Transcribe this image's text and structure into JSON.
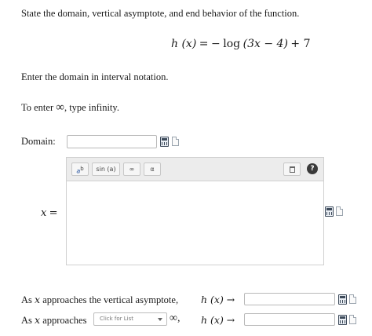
{
  "question": {
    "prompt": "State the domain, vertical asymptote, and end behavior of the function.",
    "function_lhs": "h (x)",
    "function_eq": "=",
    "function_minus": "−",
    "function_log": "log",
    "function_arg": "(3x − 4)",
    "function_plus": "+ 7"
  },
  "instructions": {
    "interval": "Enter the domain in interval notation.",
    "infinity_prefix": "To enter",
    "infinity_symbol": "∞",
    "infinity_suffix": ", type infinity."
  },
  "domain": {
    "label": "Domain:",
    "value": ""
  },
  "toolbar": {
    "power_base": "a",
    "power_exp": "b",
    "sin_label": "sin (a)",
    "infinity_label": "∞",
    "alpha_label": "α",
    "help_label": "?"
  },
  "asymptote": {
    "var": "x",
    "eq": "="
  },
  "end_behavior": {
    "row1_prefix": "As",
    "row1_var": "x",
    "row1_text": "approaches the vertical asymptote,",
    "row1_func": "h (x) →",
    "row2_prefix": "As",
    "row2_var": "x",
    "row2_text": "approaches",
    "row2_select_placeholder": "Click for List",
    "row2_infinity": "∞,",
    "row2_func": "h (x) →"
  }
}
